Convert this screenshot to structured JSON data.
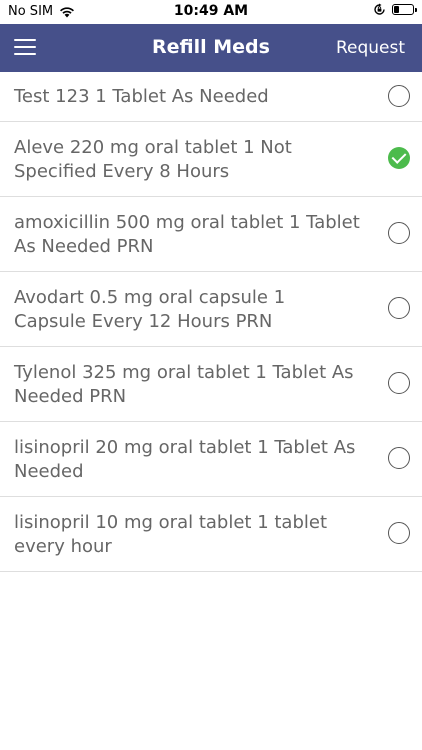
{
  "status": {
    "carrier": "No SIM",
    "time": "10:49 AM"
  },
  "navbar": {
    "title": "Refill Meds",
    "action": "Request"
  },
  "meds": [
    {
      "label": "Test 123 1 Tablet As Needed",
      "checked": false
    },
    {
      "label": "Aleve 220 mg oral tablet 1 Not Specified Every 8 Hours",
      "checked": true
    },
    {
      "label": "amoxicillin 500 mg oral tablet 1 Tablet As Needed PRN",
      "checked": false
    },
    {
      "label": "Avodart 0.5 mg oral capsule 1 Capsule Every 12 Hours PRN",
      "checked": false
    },
    {
      "label": "Tylenol 325 mg oral tablet 1 Tablet As Needed PRN",
      "checked": false
    },
    {
      "label": "lisinopril 20 mg oral tablet 1 Tablet As Needed",
      "checked": false
    },
    {
      "label": "lisinopril 10 mg oral tablet 1 tablet every hour",
      "checked": false
    }
  ],
  "colors": {
    "navbar": "#46508a",
    "check": "#4cbb4c"
  },
  "battery_level": 0.25
}
